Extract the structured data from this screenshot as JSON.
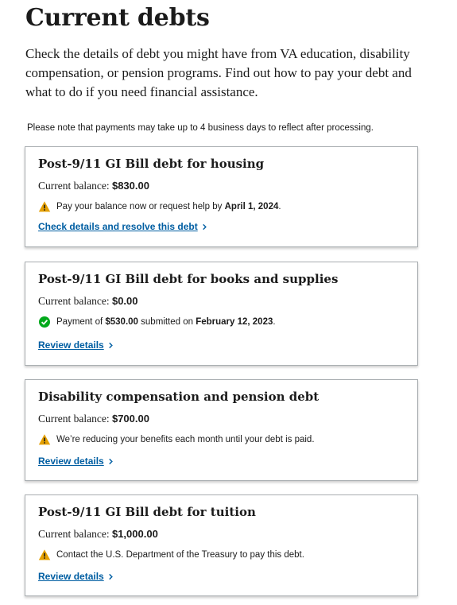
{
  "page": {
    "title": "Current debts",
    "intro": "Check the details of debt you might have from VA education, disability compensation, or pension programs. Find out how to pay your debt and what to do if you need financial assistance.",
    "note": "Please note that payments may take up to 4 business days to reflect after processing."
  },
  "colors": {
    "link": "#005ea2",
    "warning": "#e5a000",
    "success": "#00a91c",
    "border": "#a9aeb1"
  },
  "debts": [
    {
      "title": "Post-9/11 GI Bill debt for housing",
      "balance_label": "Current balance: ",
      "balance": "$830.00",
      "status_icon": "warning-icon",
      "status_pre": "Pay your balance now or request help by ",
      "status_bold": "April 1, 2024",
      "status_post": ".",
      "link": "Check details and resolve this debt"
    },
    {
      "title": "Post-9/11 GI Bill debt for books and supplies",
      "balance_label": "Current balance: ",
      "balance": "$0.00",
      "status_icon": "check-circle-icon",
      "status_pre": "Payment of ",
      "status_bold": "$530.00",
      "status_mid": " submitted on ",
      "status_bold2": "February 12, 2023",
      "status_post": ".",
      "link": "Review details"
    },
    {
      "title": "Disability compensation and pension debt",
      "balance_label": "Current balance: ",
      "balance": "$700.00",
      "status_icon": "warning-icon",
      "status_pre": "We’re reducing your benefits each month until your debt is paid.",
      "link": "Review details"
    },
    {
      "title": "Post-9/11 GI Bill debt for tuition",
      "balance_label": "Current balance: ",
      "balance": "$1,000.00",
      "status_icon": "warning-icon",
      "status_pre": "Contact the U.S. Department of the Treasury to pay this debt.",
      "link": "Review details"
    }
  ]
}
